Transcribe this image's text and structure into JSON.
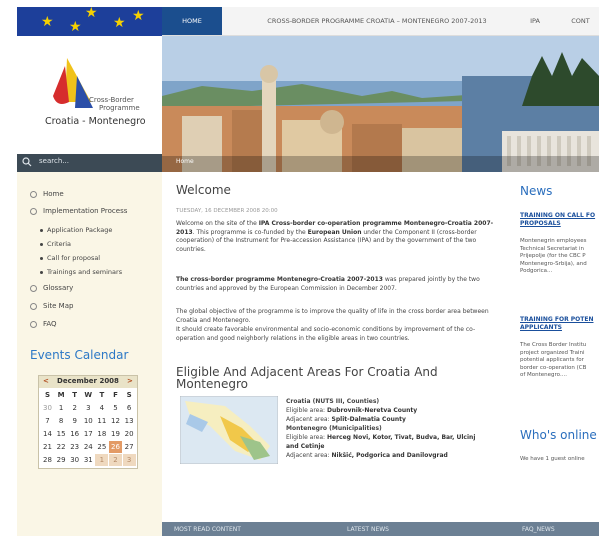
{
  "brand": {
    "logo_line1": "Cross-Border",
    "logo_line2": "Programme",
    "logo_line3": "Croatia - Montenegro"
  },
  "search": {
    "placeholder": "search..."
  },
  "nav": {
    "tabs": [
      "HOME",
      "CROSS-BORDER PROGRAMME CROATIA – MONTENEGRO 2007-2013",
      "IPA",
      "CONT"
    ]
  },
  "banner": {
    "breadcrumb": "Home"
  },
  "sidebar": {
    "items": [
      "Home",
      "Implementation Process",
      "Glossary",
      "Site Map",
      "FAQ"
    ],
    "subitems": [
      "Application Package",
      "Criteria",
      "Call for proposal",
      "Trainings and seminars"
    ]
  },
  "calendar": {
    "title": "Events Calendar",
    "prev": "<",
    "next": ">",
    "month": "December 2008",
    "days": [
      "S",
      "M",
      "T",
      "W",
      "T",
      "F",
      "S"
    ],
    "rows": [
      [
        "30",
        "1",
        "2",
        "3",
        "4",
        "5",
        "6"
      ],
      [
        "7",
        "8",
        "9",
        "10",
        "11",
        "12",
        "13"
      ],
      [
        "14",
        "15",
        "16",
        "17",
        "18",
        "19",
        "20"
      ],
      [
        "21",
        "22",
        "23",
        "24",
        "25",
        "26",
        "27"
      ],
      [
        "28",
        "29",
        "30",
        "31",
        "1",
        "2",
        "3"
      ]
    ]
  },
  "main": {
    "welcome_title": "Welcome",
    "date": "TUESDAY, 16 DECEMBER 2008 20:00",
    "p1_a": "Welcome on the site of the ",
    "p1_b": "IPA Cross-border co-operation programme Montenegro-Croatia 2007-2013",
    "p1_c": ". This programme is co-funded by the ",
    "p1_d": "European Union",
    "p1_e": " under the Component II (cross-border cooperation) of the Instrument for Pre-accession Assistance (IPA) and by the government of the two countries.",
    "p2_a": "The cross-border programme Montenegro-Croatia 2007-2013",
    "p2_b": " was prepared jointly by the two countries and approved by the European Commission in December 2007.",
    "p3": "The global objective of the programme is to improve the quality of life in the cross border area between Croatia and Montenegro.",
    "p4": "It should create favorable environmental and socio-economic conditions by improvement of the co-operation and good neighborly relations in the eligible areas in two countries.",
    "areas_title": "Eligible And Adjacent Areas For Croatia And Montenegro",
    "areas": [
      {
        "label": "Croatia (NUTS III, Counties)",
        "bold": true
      },
      {
        "label": "Eligible area: ",
        "value": "Dubrovnik-Neretva County"
      },
      {
        "label": "Adjacent area: ",
        "value": "Split-Dalmatia County"
      },
      {
        "label": "Montenegro (Municipalities)",
        "bold": true
      },
      {
        "label": "Eligible area: ",
        "value": "Herceg Novi, Kotor, Tivat, Budva, Bar, Ulcinj"
      },
      {
        "label": "",
        "value": "and Cetinje"
      },
      {
        "label": "Adjacent area: ",
        "value": "Nikšić, Podgorica and Danilovgrad"
      }
    ]
  },
  "news": {
    "title": "News",
    "item1_title_l1": "TRAINING ON CALL FO",
    "item1_title_l2": "PROPOSALS",
    "item1_text": [
      "Montenegrin employees",
      "Technical Secretariat in",
      "Prijepolje (for the CBC P",
      "Montenegro-Srbija), and",
      "Podgorica..."
    ],
    "item2_title_l1": "TRAINING FOR POTEN",
    "item2_title_l2": "APPLICANTS",
    "item2_text": [
      "The Cross Border Institu",
      "project organized Traini",
      "potential applicants for",
      "border co-operation (CB",
      "of Montenegro...."
    ],
    "whos_online": "Who's online",
    "online_text": "We have 1 guest online"
  },
  "footer_tabs": [
    "MOST READ CONTENT",
    "LATEST NEWS",
    "FAQ_NEWS"
  ],
  "colors": {
    "nav_active": "#1b4e8e",
    "calendar_today": "#e39b66",
    "news_heading": "#2a6ebd"
  }
}
